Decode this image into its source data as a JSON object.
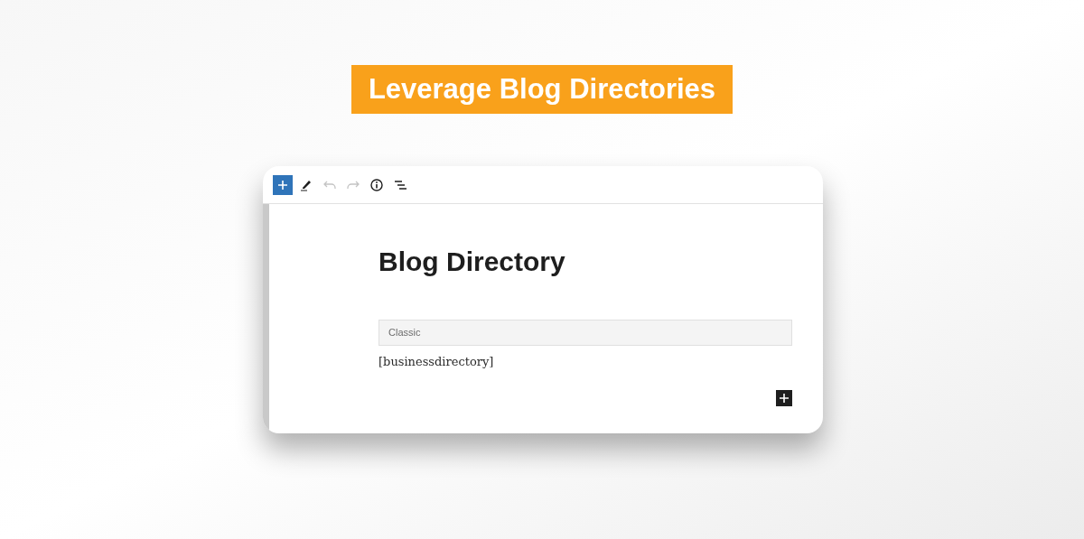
{
  "banner": {
    "title": "Leverage Blog Directories"
  },
  "toolbar": {
    "buttons": [
      {
        "kind": "add",
        "disabled": false
      },
      {
        "kind": "edit",
        "disabled": false
      },
      {
        "kind": "undo",
        "disabled": true
      },
      {
        "kind": "redo",
        "disabled": true
      },
      {
        "kind": "info",
        "disabled": false
      },
      {
        "kind": "outline",
        "disabled": false
      }
    ]
  },
  "editor": {
    "title": "Blog Directory",
    "block_label": "Classic",
    "shortcode": "[businessdirectory]"
  }
}
